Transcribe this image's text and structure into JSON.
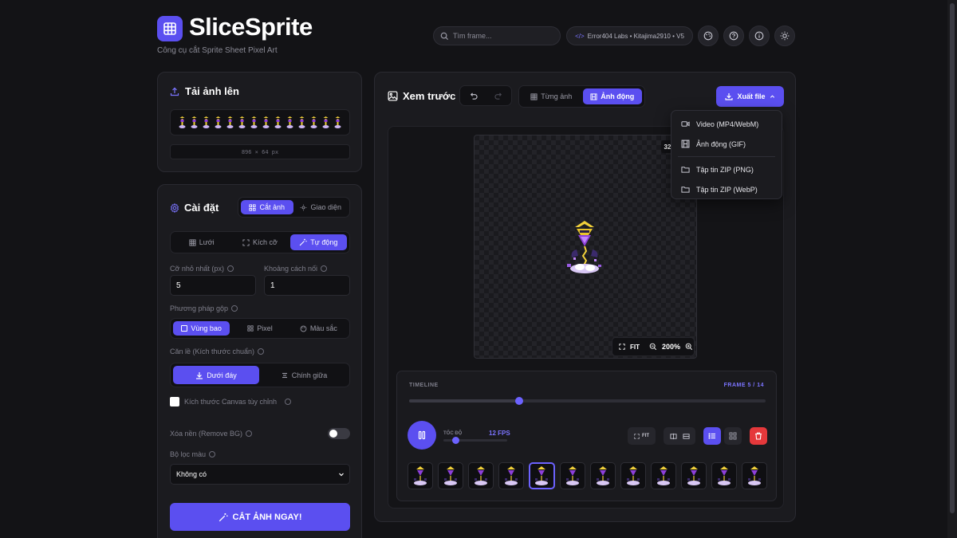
{
  "app": {
    "brand": "SliceSprite",
    "tagline": "Công cụ cắt Sprite Sheet Pixel Art"
  },
  "header": {
    "search_placeholder": "Tìm frame...",
    "credit_text": "Error404 Labs • Kitajima2910 • V5",
    "icons": [
      "palette-icon",
      "help-icon",
      "info-icon",
      "theme-icon"
    ]
  },
  "upload": {
    "title": "Tải ảnh lên",
    "dimensions": "896 × 64 px"
  },
  "settings": {
    "title": "Cài đặt",
    "tabs": [
      "Cắt ảnh",
      "Giao diện"
    ],
    "active_tab": "Cắt ảnh",
    "modes": [
      "Lưới",
      "Kích cỡ",
      "Tự động"
    ],
    "active_mode": "Tự động",
    "min_size_label": "Cỡ nhỏ nhất (px)",
    "min_size_value": "5",
    "gap_label": "Khoảng cách nối",
    "gap_value": "1",
    "merge_label": "Phương pháp gộp",
    "merge_options": [
      "Vùng bao",
      "Pixel",
      "Màu sắc"
    ],
    "merge_active": "Vùng bao",
    "align_label": "Căn lề (Kích thước chuẩn)",
    "align_options": [
      "Dưới đáy",
      "Chính giữa"
    ],
    "align_active": "Dưới đáy",
    "custom_canvas_label": "Kích thước Canvas tùy chỉnh",
    "custom_canvas_checked": false,
    "remove_bg_label": "Xóa nền (Remove BG)",
    "remove_bg_on": false,
    "color_filter_label": "Bộ lọc màu",
    "color_filter_value": "Không có",
    "cut_button": "CẮT ẢNH NGAY!"
  },
  "preview": {
    "title": "Xem trước",
    "view_tabs": [
      "Từng ảnh",
      "Ảnh động"
    ],
    "active_view": "Ảnh động",
    "export_label": "Xuất file",
    "export_menu": [
      "Video (MP4/WebM)",
      "Ảnh động (GIF)",
      "Tập tin ZIP (PNG)",
      "Tập tin ZIP (WebP)"
    ],
    "canvas_badge": "32",
    "fit_label": "FIT",
    "zoom": "200%"
  },
  "timeline": {
    "label": "TIMELINE",
    "frame_text": "FRAME 5 / 14",
    "current_frame": 5,
    "total_frames": 14,
    "speed_label": "TỐC ĐỘ",
    "speed_value": "12 FPS",
    "fit_label": "FIT",
    "visible_thumbs": 12,
    "selected_thumb": 5
  },
  "colors": {
    "accent": "#5b4ff0",
    "background": "#131316",
    "panel": "#1b1b1f",
    "danger": "#e5383b"
  }
}
